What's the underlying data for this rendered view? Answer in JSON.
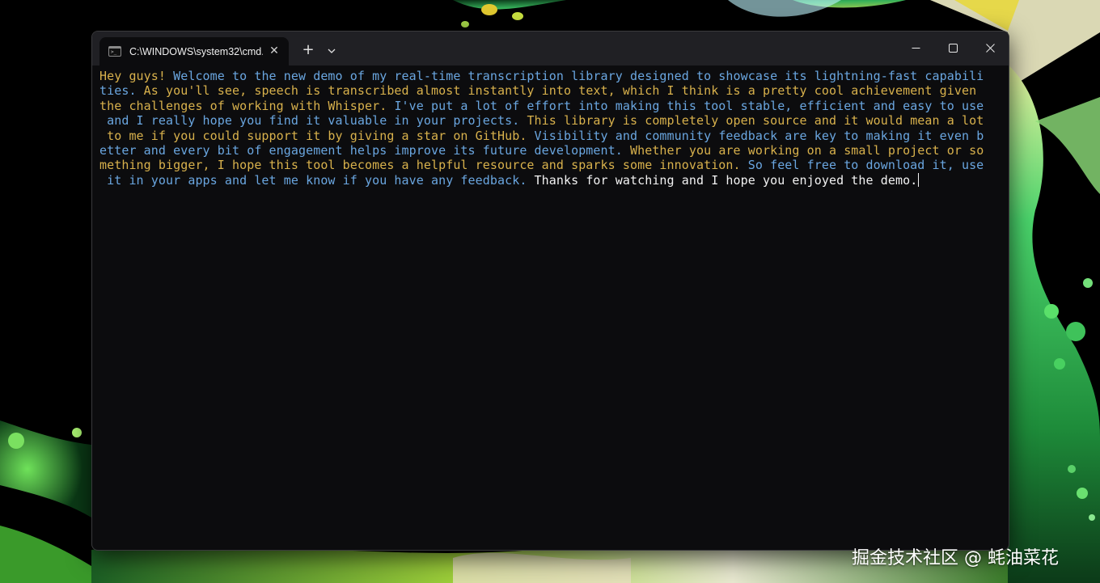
{
  "window": {
    "tab_title": "C:\\WINDOWS\\system32\\cmd.",
    "tab_icon": "console-icon",
    "tab_close_icon": "close-icon",
    "new_tab_icon": "plus-icon",
    "tab_dropdown_icon": "chevron-down-icon",
    "minimize_icon": "minimize-icon",
    "maximize_icon": "maximize-icon",
    "close_window_icon": "close-icon"
  },
  "colors": {
    "yellow_text": "#d8b14c",
    "blue_text": "#6aa6e0",
    "white_text": "#f2f2f2",
    "terminal_bg": "#0c0c0e",
    "titlebar_bg": "#202024"
  },
  "terminal": {
    "lines": [
      [
        {
          "color": "yellow",
          "text": "Hey guys! "
        },
        {
          "color": "blue",
          "text": "Welcome to the new demo of my real-time transcription library designed to showcase its lightning-fast capabili"
        }
      ],
      [
        {
          "color": "blue",
          "text": "ties. "
        },
        {
          "color": "yellow",
          "text": "As you'll see, speech is transcribed almost instantly into text, which I think is a pretty cool achievement given"
        }
      ],
      [
        {
          "color": "yellow",
          "text": "the challenges of working with Whisper. "
        },
        {
          "color": "blue",
          "text": "I've put a lot of effort into making this tool stable, efficient and easy to use"
        }
      ],
      [
        {
          "color": "blue",
          "text": " and I really hope you find it valuable in your projects. "
        },
        {
          "color": "yellow",
          "text": "This library is completely open source and it would mean a lot"
        }
      ],
      [
        {
          "color": "yellow",
          "text": " to me if you could support it by giving a star on GitHub. "
        },
        {
          "color": "blue",
          "text": "Visibility and community feedback are key to making it even b"
        }
      ],
      [
        {
          "color": "blue",
          "text": "etter and every bit of engagement helps improve its future development. "
        },
        {
          "color": "yellow",
          "text": "Whether you are working on a small project or so"
        }
      ],
      [
        {
          "color": "yellow",
          "text": "mething bigger, I hope this tool becomes a helpful resource and sparks some innovation. "
        },
        {
          "color": "blue",
          "text": "So feel free to download it, use"
        }
      ],
      [
        {
          "color": "blue",
          "text": " it in your apps and let me know if you have any feedback. "
        },
        {
          "color": "white",
          "text": "Thanks for watching and I hope you enjoyed the demo."
        }
      ]
    ]
  },
  "watermark": "掘金技术社区 @ 蚝油菜花"
}
